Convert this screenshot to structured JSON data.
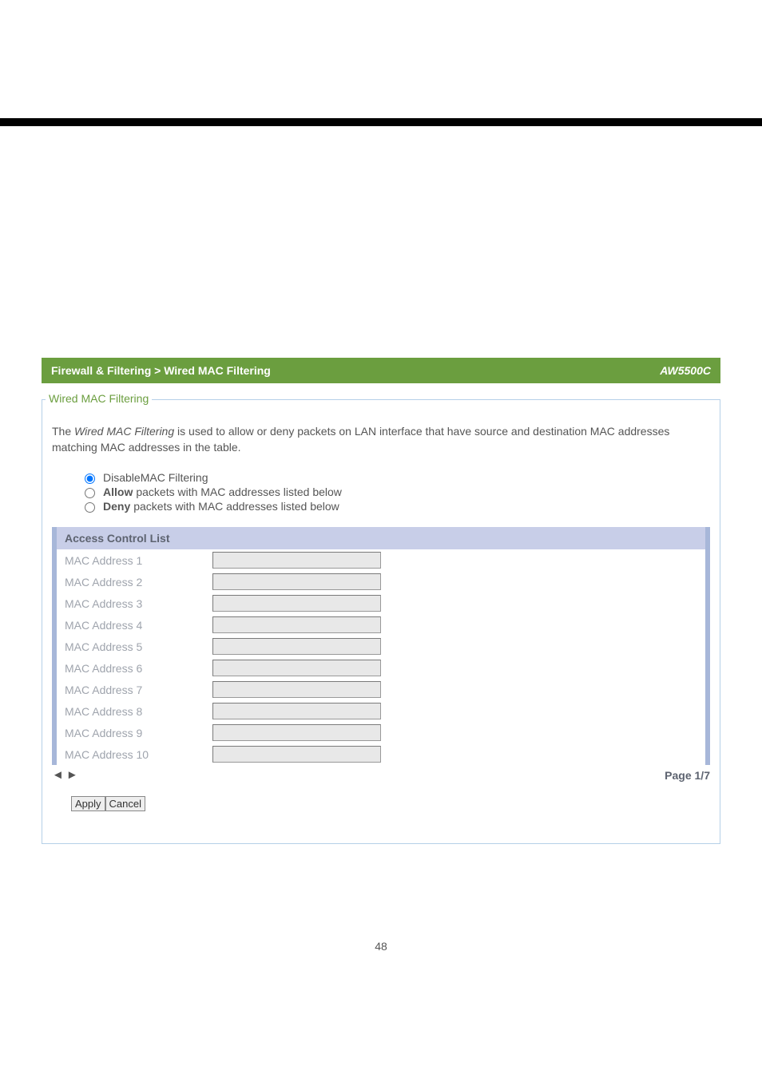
{
  "header": {
    "breadcrumb": "Firewall & Filtering > Wired MAC Filtering",
    "model": "AW5500C"
  },
  "fieldset_legend": "Wired MAC Filtering",
  "description_prefix": "The ",
  "description_italic": "Wired MAC Filtering",
  "description_suffix": " is used to allow or deny packets on LAN interface that have source and destination MAC addresses matching MAC addresses in the table.",
  "radios": {
    "disable": "DisableMAC Filtering",
    "allow_bold": "Allow",
    "allow_rest": " packets with MAC addresses listed below",
    "deny_bold": "Deny",
    "deny_rest": " packets with MAC addresses listed below"
  },
  "acl_header": "Access Control List",
  "acl_rows": [
    {
      "label": "MAC Address 1",
      "value": ""
    },
    {
      "label": "MAC Address 2",
      "value": ""
    },
    {
      "label": "MAC Address 3",
      "value": ""
    },
    {
      "label": "MAC Address 4",
      "value": ""
    },
    {
      "label": "MAC Address 5",
      "value": ""
    },
    {
      "label": "MAC Address 6",
      "value": ""
    },
    {
      "label": "MAC Address 7",
      "value": ""
    },
    {
      "label": "MAC Address 8",
      "value": ""
    },
    {
      "label": "MAC Address 9",
      "value": ""
    },
    {
      "label": "MAC Address 10",
      "value": ""
    }
  ],
  "pager": {
    "prev": "◄",
    "next": "►",
    "page_label": "Page 1/7"
  },
  "buttons": {
    "apply": "Apply",
    "cancel": "Cancel"
  },
  "page_number": "48"
}
